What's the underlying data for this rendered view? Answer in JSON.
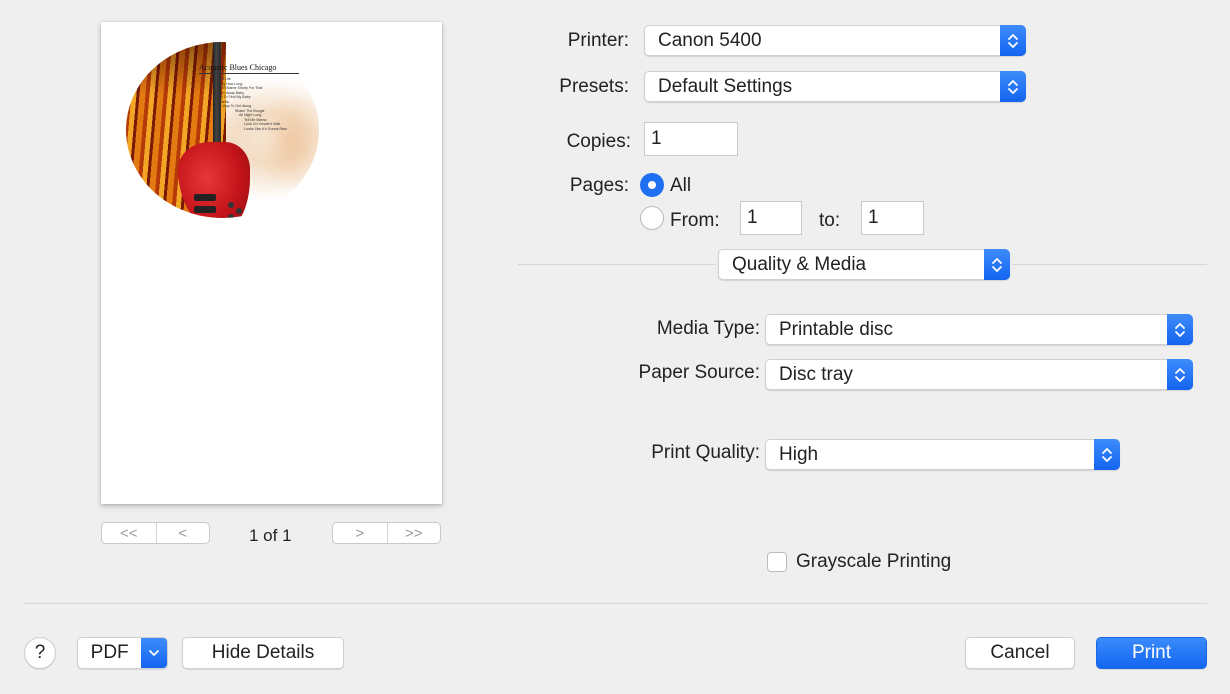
{
  "preview": {
    "disc_title": "Acoustic Blues Chicago",
    "tracks": [
      "Fast Life",
      "Baby How Long",
      "Don't Blame Shorty For That",
      "Goin' Away Baby",
      "Got To Find My Baby",
      "Ludella",
      "No Way To Get Along",
      "Shake The Boogie",
      "All Night Long",
      "Tell Me Mama",
      "Look On Yonder's Wall",
      "Looks Like It's Gonna Rain"
    ],
    "page_indicator": "1 of 1",
    "first_page_glyph": "<<",
    "prev_page_glyph": "<",
    "next_page_glyph": ">",
    "last_page_glyph": ">>"
  },
  "printer": {
    "label": "Printer:",
    "value": "Canon 5400"
  },
  "presets": {
    "label": "Presets:",
    "value": "Default Settings"
  },
  "copies": {
    "label": "Copies:",
    "value": "1"
  },
  "pages": {
    "label": "Pages:",
    "all_label": "All",
    "all_selected": true,
    "from_label": "From:",
    "from_value": "1",
    "to_label": "to:",
    "to_value": "1"
  },
  "panel_selector": {
    "value": "Quality & Media"
  },
  "media_type": {
    "label": "Media Type:",
    "value": "Printable disc"
  },
  "paper_source": {
    "label": "Paper Source:",
    "value": "Disc tray"
  },
  "print_quality": {
    "label": "Print Quality:",
    "value": "High"
  },
  "grayscale": {
    "label": "Grayscale Printing",
    "checked": false
  },
  "footer": {
    "help_label": "?",
    "pdf_label": "PDF",
    "hide_details_label": "Hide Details",
    "cancel_label": "Cancel",
    "print_label": "Print"
  },
  "colors": {
    "accent": "#1f6ff2",
    "background": "#efefef"
  }
}
